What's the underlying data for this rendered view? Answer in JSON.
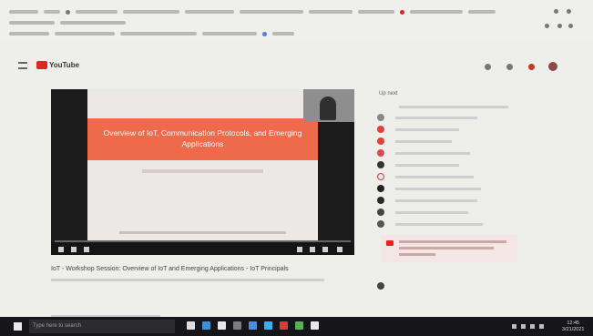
{
  "youtube": {
    "logo_text": "YouTube"
  },
  "player": {
    "slide_title": "Overview of IoT, Communication Protocols, and Emerging Applications",
    "progress_fraction": 0.0
  },
  "video": {
    "title": "IoT - Workshop Session: Overview of IoT and Emerging Applications - IoT Principals"
  },
  "sidebar": {
    "heading": "Up next"
  },
  "taskbar": {
    "search_placeholder": "Type here to search",
    "time": "12:45",
    "date": "3/21/2021"
  },
  "colors": {
    "brand_red": "#e32424",
    "slide_banner": "#ee6a4a",
    "taskbar": "#16161a"
  },
  "icons": [
    "hamburger-icon",
    "youtube-play-icon",
    "search-icon",
    "apps-icon",
    "bell-icon",
    "avatar",
    "play-icon",
    "volume-icon",
    "settings-icon",
    "fullscreen-icon",
    "windows-start-icon",
    "task-view-icon",
    "edge-icon",
    "file-explorer-icon",
    "chrome-icon"
  ]
}
